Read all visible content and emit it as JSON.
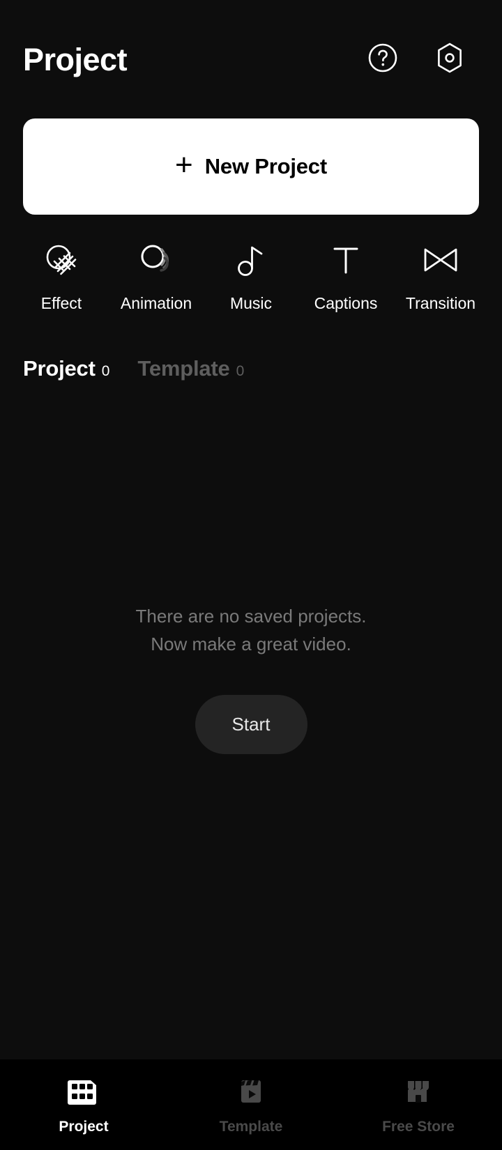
{
  "header": {
    "title": "Project",
    "help_icon": "help-circle-icon",
    "settings_icon": "hexagon-settings-icon"
  },
  "new_project": {
    "plus": "+",
    "label": "New Project"
  },
  "features": [
    {
      "label": "Effect",
      "icon": "effect-hatched-circle-icon"
    },
    {
      "label": "Animation",
      "icon": "animation-motion-circle-icon"
    },
    {
      "label": "Music",
      "icon": "music-note-icon"
    },
    {
      "label": "Captions",
      "icon": "captions-text-t-icon"
    },
    {
      "label": "Transition",
      "icon": "transition-bowtie-icon"
    }
  ],
  "tabs": [
    {
      "label": "Project",
      "count": "0",
      "active": true
    },
    {
      "label": "Template",
      "count": "0",
      "active": false
    }
  ],
  "empty_state": {
    "line1": "There are no saved projects.",
    "line2": "Now make a great video.",
    "start_label": "Start"
  },
  "bottom_nav": [
    {
      "label": "Project",
      "icon": "film-strip-icon",
      "active": true
    },
    {
      "label": "Template",
      "icon": "clapperboard-icon",
      "active": false
    },
    {
      "label": "Free Store",
      "icon": "storefront-icon",
      "active": false
    }
  ],
  "colors": {
    "background": "#0d0d0d",
    "nav_background": "#000000",
    "accent_white": "#ffffff",
    "muted_text": "#7a7a7a",
    "inactive": "#5e5e5e",
    "start_button": "#242424"
  }
}
